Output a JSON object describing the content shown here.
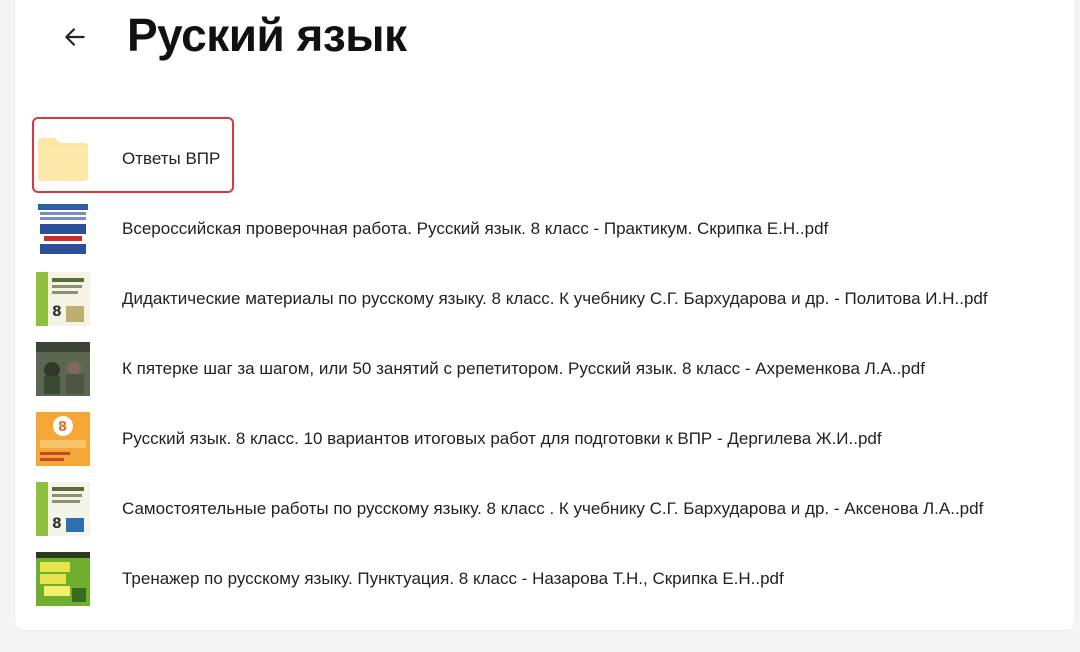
{
  "header": {
    "title": "Руский язык"
  },
  "colors": {
    "folder": "#fbe7a1",
    "highlight": "#d9393e"
  },
  "items": [
    {
      "kind": "folder",
      "name": "Ответы ВПР",
      "icon": "folder-icon"
    },
    {
      "kind": "file",
      "name": "Всероссийская проверочная работа. Русский язык. 8 класс - Практикум. Скрипка Е.Н..pdf",
      "icon": "book-cover-thumbnail"
    },
    {
      "kind": "file",
      "name": "Дидактические материалы по русскому языку. 8 класс. К учебнику С.Г. Бархударова и др. - Политова И.Н..pdf",
      "icon": "book-cover-thumbnail"
    },
    {
      "kind": "file",
      "name": "К пятерке шаг за шагом, или 50 занятий с репетитором. Русский язык. 8 класс - Ахременкова Л.А..pdf",
      "icon": "book-cover-thumbnail"
    },
    {
      "kind": "file",
      "name": "Русский язык. 8 класс. 10 вариантов итоговых работ для подготовки к ВПР - Дергилева Ж.И..pdf",
      "icon": "book-cover-thumbnail"
    },
    {
      "kind": "file",
      "name": "Самостоятельные работы по русскому языку. 8 класс . К учебнику С.Г. Бархударова и др. - Аксенова Л.А..pdf",
      "icon": "book-cover-thumbnail"
    },
    {
      "kind": "file",
      "name": "Тренажер по русскому языку. Пунктуация. 8 класс - Назарова Т.Н., Скрипка Е.Н..pdf",
      "icon": "book-cover-thumbnail"
    }
  ]
}
